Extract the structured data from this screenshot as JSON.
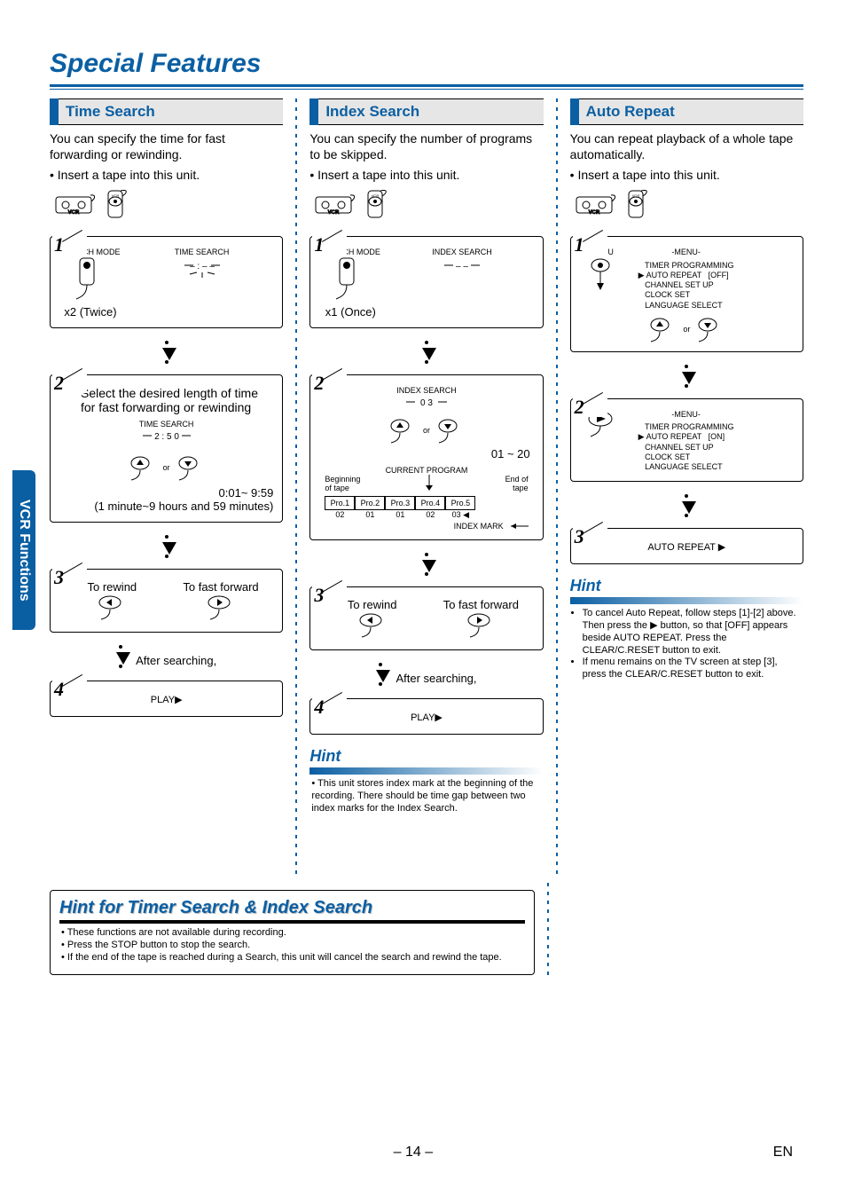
{
  "page": {
    "title": "Special Features",
    "page_number": "– 14 –",
    "lang_code": "EN",
    "side_tab": "VCR Functions"
  },
  "time_search": {
    "heading": "Time Search",
    "intro": "You can specify the time for fast forwarding or rewinding.",
    "bullet": "• Insert a tape into this unit.",
    "step1_osd": "TIME SEARCH",
    "step1_press": "x2 (Twice)",
    "step1_mode": "SEARCH MODE",
    "step2_text": "Select the desired length of time for fast forwarding or rewinding",
    "step2_osd": "TIME SEARCH",
    "step2_val": "2 : 5 0",
    "step2_range": "0:01~ 9:59",
    "step2_note": "(1 minute~9 hours and 59 minutes)",
    "step2_or": "or",
    "step3_left": "To rewind",
    "step3_right": "To fast forward",
    "step3_after": "After searching,",
    "step4_osd": "PLAY▶"
  },
  "index_search": {
    "heading": "Index Search",
    "intro": "You can specify the number of programs to be skipped.",
    "bullet": "• Insert a tape into this unit.",
    "step1_osd": "INDEX SEARCH",
    "step1_press": "x1 (Once)",
    "step1_mode": "SEARCH MODE",
    "step2_osd": "INDEX SEARCH",
    "step2_val": "0 3",
    "step2_or": "or",
    "step2_range": "01 ~ 20",
    "step2_current": "CURRENT PROGRAM",
    "step2_begin": "Beginning of tape",
    "step2_end": "End of tape",
    "step2_pro": [
      "Pro.1",
      "Pro.2",
      "Pro.3",
      "Pro.4",
      "Pro.5"
    ],
    "step2_idx": [
      "02",
      "01",
      "01",
      "02",
      "03"
    ],
    "step2_mark": "INDEX MARK",
    "step3_left": "To rewind",
    "step3_right": "To fast forward",
    "step3_after": "After searching,",
    "step4_osd": "PLAY▶",
    "hint_title": "Hint",
    "hint_body": "• This unit stores index mark at the beginning of the recording. There should be time gap between two index marks for the Index Search."
  },
  "auto_repeat": {
    "heading": "Auto Repeat",
    "intro": "You can repeat playback of a whole tape automatically.",
    "bullet": "• Insert a tape into this unit.",
    "step1_btn": "MENU",
    "step1_menu_title": "-MENU-",
    "step1_menu_items": [
      "TIMER PROGRAMMING",
      "AUTO REPEAT   [OFF]",
      "CHANNEL SET UP",
      "CLOCK SET",
      "LANGUAGE SELECT"
    ],
    "step1_or": "or",
    "step2_menu_title": "-MENU-",
    "step2_menu_items": [
      "TIMER PROGRAMMING",
      "AUTO REPEAT   [ON]",
      "CHANNEL SET UP",
      "CLOCK SET",
      "LANGUAGE SELECT"
    ],
    "step3_osd": "AUTO REPEAT ▶",
    "hint_title": "Hint",
    "hint_items": [
      "To cancel Auto Repeat, follow steps [1]-[2] above. Then press the ▶ button, so that [OFF] appears beside AUTO REPEAT.  Press the CLEAR/C.RESET button to exit.",
      "If menu remains on the TV screen at step [3], press the CLEAR/C.RESET button to exit."
    ]
  },
  "combined_hint": {
    "title": "Hint for Timer Search & Index Search",
    "items": [
      "These functions are not available during recording.",
      "Press the STOP button to stop the search.",
      "If the end of the tape is reached during a Search, this unit will cancel the search and rewind the tape."
    ]
  }
}
